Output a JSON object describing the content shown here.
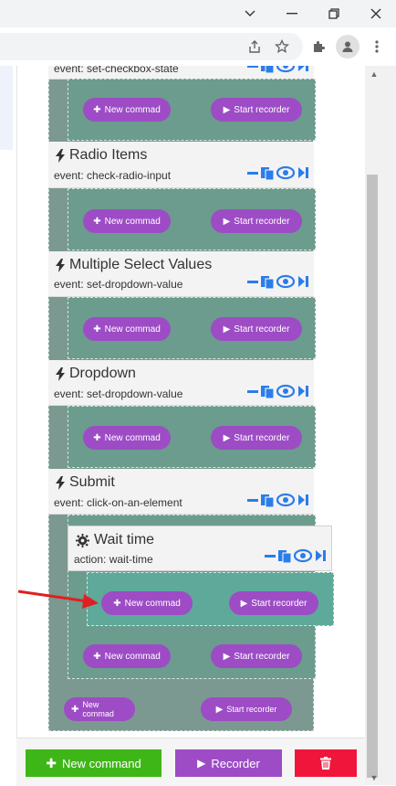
{
  "window": {
    "controls": {
      "collapse": "⌄",
      "minimize": "—",
      "restore": "❐",
      "close": "✕"
    }
  },
  "toolbar": {
    "share_icon": "share-icon",
    "bookmark_icon": "star-icon",
    "extensions_icon": "puzzle-icon",
    "profile_icon": "profile-icon",
    "menu_icon": "kebab-menu-icon"
  },
  "commands": [
    {
      "title": "",
      "event": "event: set-checkbox-state",
      "new_cmd": "New commad",
      "start_rec": "Start recorder"
    },
    {
      "title": "Radio Items",
      "event": "event: check-radio-input",
      "new_cmd": "New commad",
      "start_rec": "Start recorder"
    },
    {
      "title": "Multiple Select Values",
      "event": "event: set-dropdown-value",
      "new_cmd": "New commad",
      "start_rec": "Start recorder"
    },
    {
      "title": "Dropdown",
      "event": "event: set-dropdown-value",
      "new_cmd": "New commad",
      "start_rec": "Start recorder"
    },
    {
      "title": "Submit",
      "event": "event: click-on-an-element",
      "new_cmd": "New commad",
      "start_rec": "Start recorder"
    }
  ],
  "nested": {
    "title": "Wait time",
    "action": "action: wait-time",
    "new_cmd": "New commad",
    "start_rec": "Start recorder"
  },
  "outer_buttons": [
    {
      "new_cmd": "New commad",
      "start_rec": "Start recorder"
    },
    {
      "new_cmd": "New commad",
      "start_rec": "Start recorder"
    }
  ],
  "bottom": {
    "new_command": "New command",
    "recorder": "Recorder",
    "colors": {
      "green": "#3fb618",
      "purple": "#9d4cc5",
      "red": "#f0163b"
    }
  }
}
